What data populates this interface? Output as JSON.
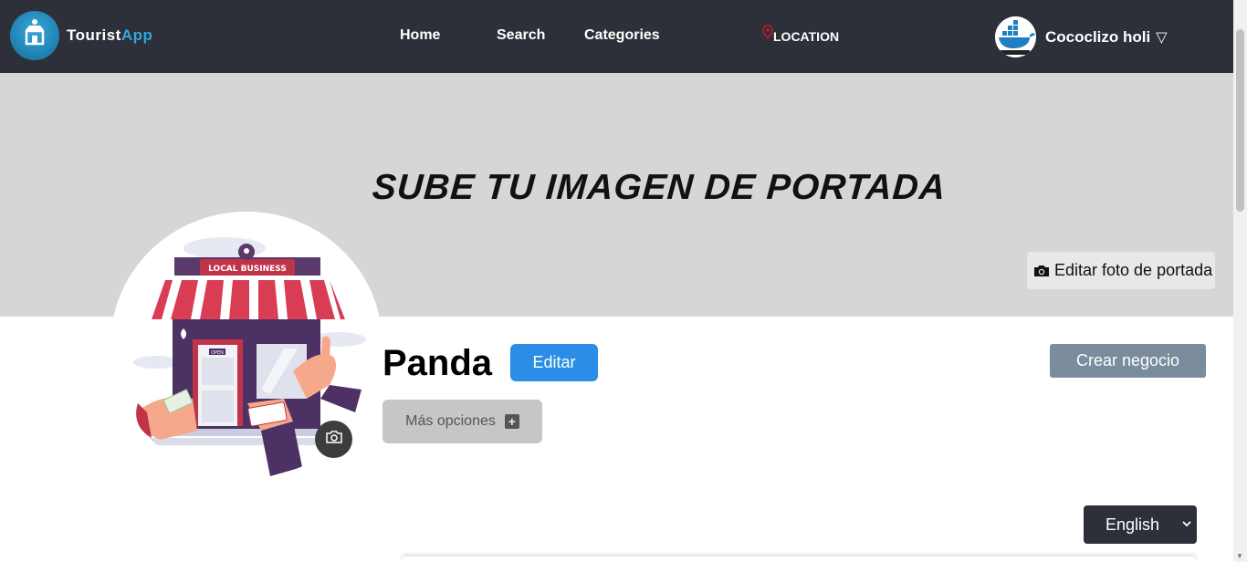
{
  "brand": {
    "name_part1": "Tourist",
    "name_part2": "App",
    "accent": "#32a6e0"
  },
  "nav": {
    "home": "Home",
    "search": "Search",
    "categories": "Categories",
    "location": "LOCATION",
    "location_icon": "map-pin-icon"
  },
  "user": {
    "name": "Cococlizo holi",
    "caret": "▽",
    "avatar_icon": "docker-whale-icon"
  },
  "cover": {
    "placeholder_text": "SUBE TU IMAGEN DE PORTADA",
    "edit_label": "Editar foto de portada",
    "background": "#d6d6d6"
  },
  "profile": {
    "name": "Panda",
    "edit_label": "Editar",
    "more_options_label": "Más opciones",
    "create_business_label": "Crear negocio",
    "avatar_sign_text": "LOCAL BUSINESS",
    "avatar_door_sign": "OPEN"
  },
  "language": {
    "selected": "English"
  },
  "colors": {
    "navbar": "#2d3038",
    "edit_button": "#2b8de6",
    "create_button": "#7a8c9e",
    "more_button": "#c6c6c6"
  }
}
